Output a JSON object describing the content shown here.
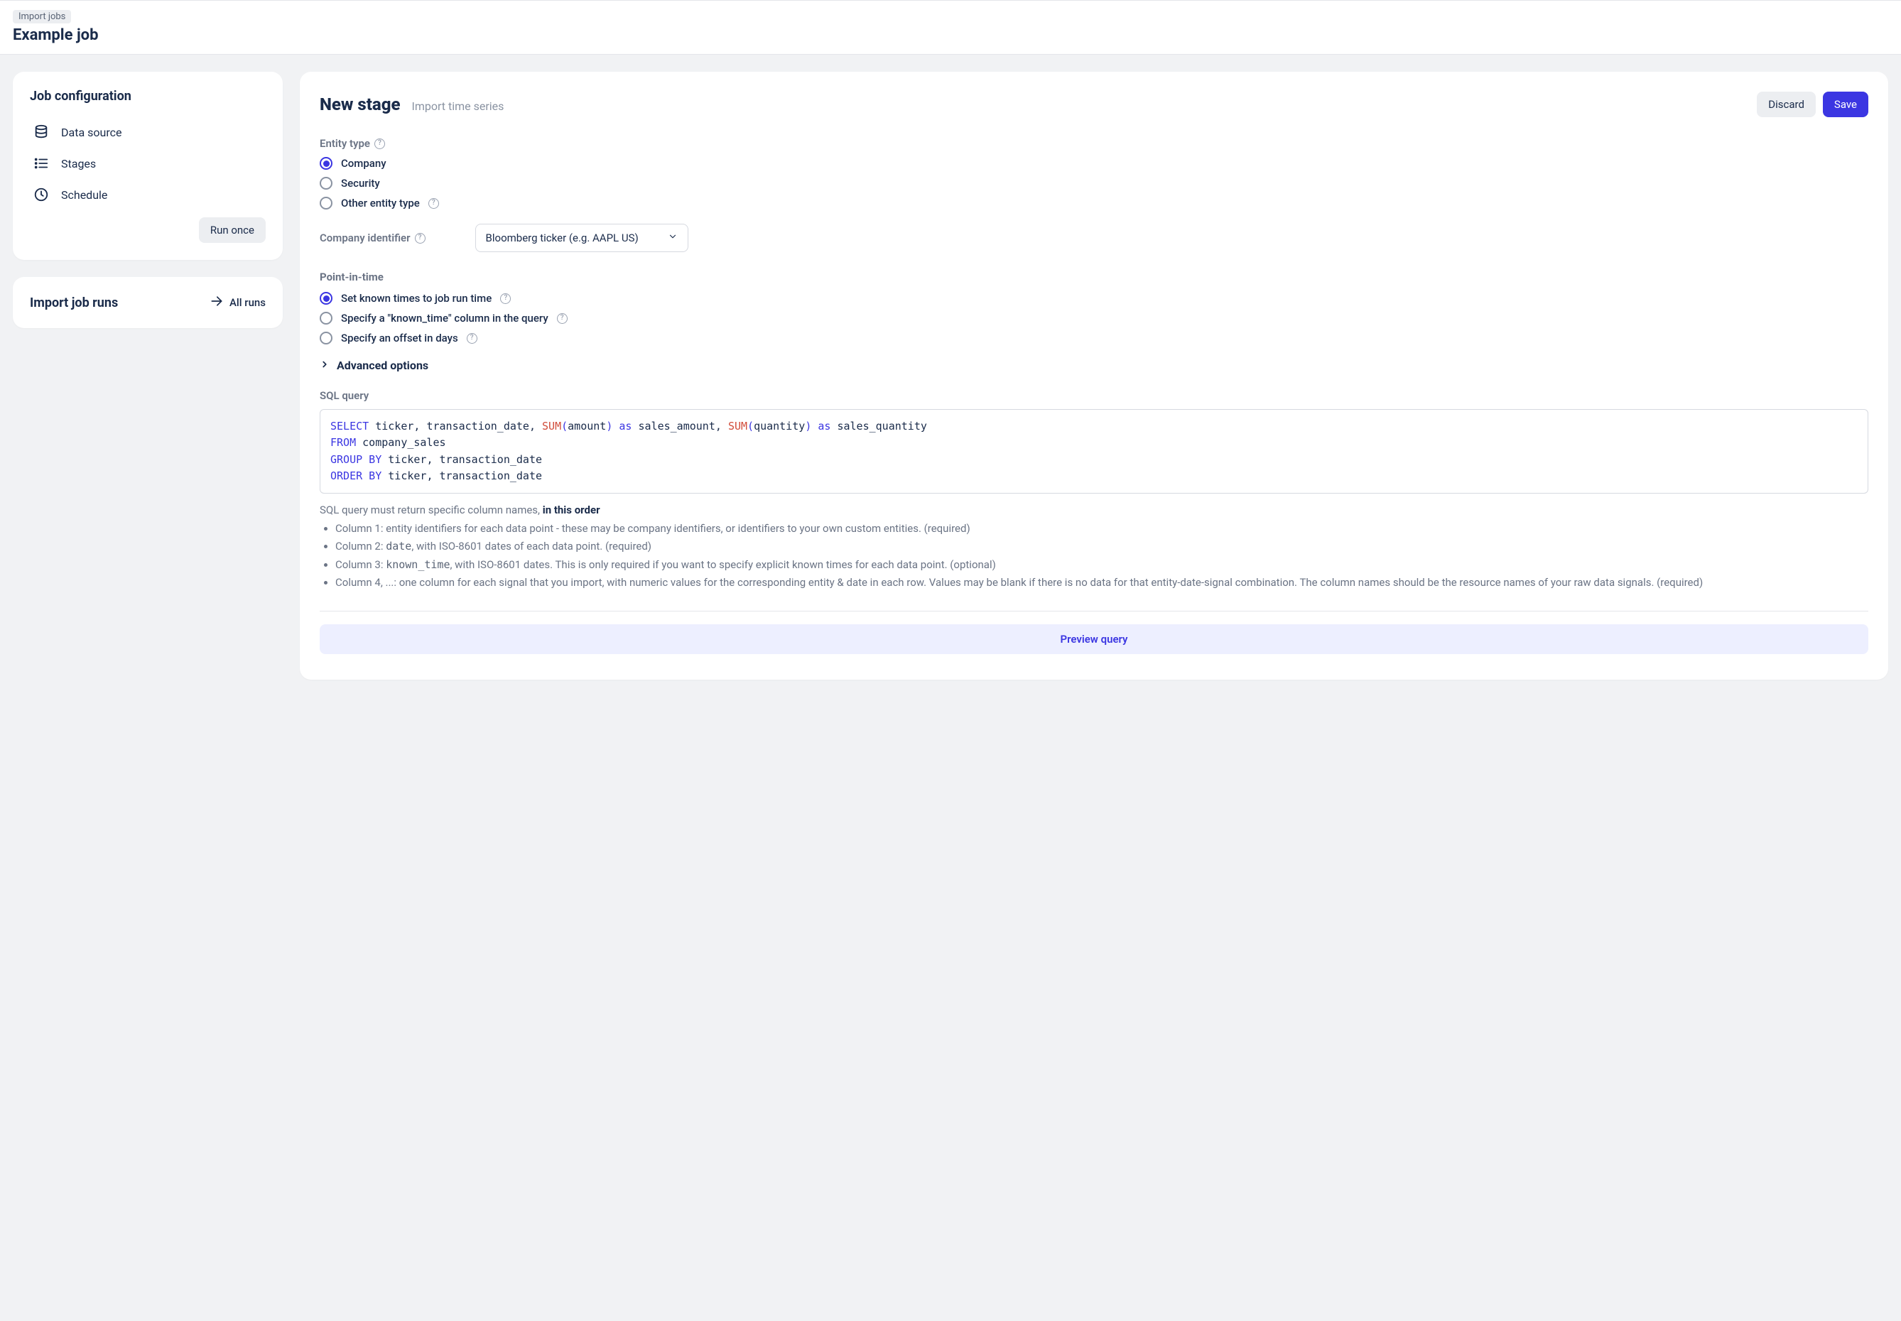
{
  "breadcrumb": "Import jobs",
  "page_title": "Example job",
  "sidebar": {
    "config_heading": "Job configuration",
    "items": [
      {
        "label": "Data source"
      },
      {
        "label": "Stages"
      },
      {
        "label": "Schedule"
      }
    ],
    "run_once": "Run once",
    "runs_heading": "Import job runs",
    "all_runs": "All runs"
  },
  "stage": {
    "title": "New stage",
    "subtitle": "Import time series",
    "discard": "Discard",
    "save": "Save"
  },
  "entity": {
    "label": "Entity type",
    "options": [
      "Company",
      "Security",
      "Other entity type"
    ],
    "identifier_label": "Company identifier",
    "identifier_value": "Bloomberg ticker (e.g. AAPL US)"
  },
  "pit": {
    "label": "Point-in-time",
    "options": [
      "Set known times to job run time",
      "Specify a \"known_time\" column in the query",
      "Specify an offset in days"
    ]
  },
  "advanced": "Advanced options",
  "sql": {
    "label": "SQL query",
    "tokens": {
      "select": "SELECT",
      "cols1": " ticker, transaction_date, ",
      "sum": "SUM",
      "lp": "(",
      "amount": "amount",
      "rp": ")",
      "as": "as",
      "alias1": " sales_amount, ",
      "quantity": "quantity",
      "alias2": " sales_quantity",
      "from": "FROM",
      "table": " company_sales",
      "groupby": "GROUP BY",
      "gcols": " ticker, transaction_date",
      "orderby": "ORDER BY",
      "ocols": " ticker, transaction_date"
    }
  },
  "hint": {
    "prefix": "SQL query must return specific column names, ",
    "strong": "in this order",
    "col1a": "Column 1: entity identifiers for each data point - these may be company identifiers, or identifiers to your own custom entities. (required)",
    "col2a": "Column 2: ",
    "col2code": "date",
    "col2b": ", with ISO-8601 dates of each data point. (required)",
    "col3a": "Column 3: ",
    "col3code": "known_time",
    "col3b": ", with ISO-8601 dates. This is only required if you want to specify explicit known times for each data point. (optional)",
    "col4": "Column 4, ...: one column for each signal that you import, with numeric values for the corresponding entity & date in each row. Values may be blank if there is no data for that entity-date-signal combination. The column names should be the resource names of your raw data signals. (required)"
  },
  "preview": "Preview query"
}
